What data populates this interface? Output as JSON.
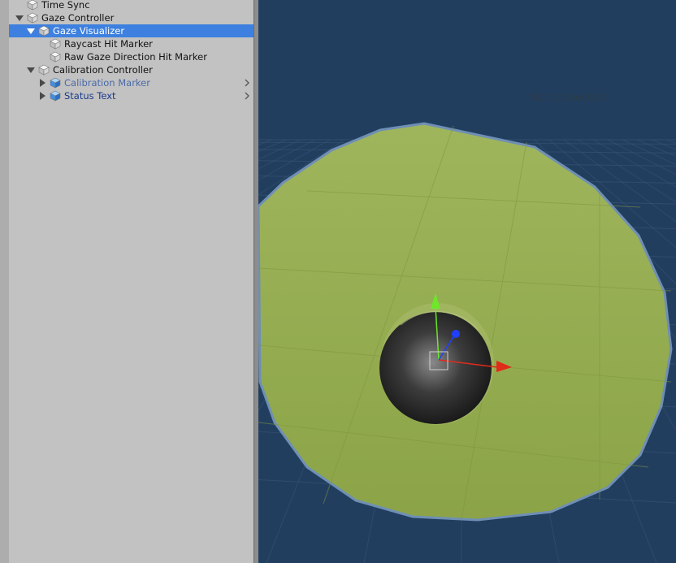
{
  "hierarchy": {
    "items": [
      {
        "label": "Time Sync",
        "indent": 1,
        "expand": "none",
        "icon": "gameobject-icon",
        "selected": false,
        "style": "normal"
      },
      {
        "label": "Gaze Controller",
        "indent": 1,
        "expand": "expanded",
        "icon": "gameobject-icon",
        "selected": false,
        "style": "normal"
      },
      {
        "label": "Gaze Visualizer",
        "indent": 2,
        "expand": "expanded",
        "icon": "gameobject-icon",
        "selected": true,
        "style": "normal"
      },
      {
        "label": "Raycast Hit Marker",
        "indent": 3,
        "expand": "none",
        "icon": "gameobject-icon",
        "selected": false,
        "style": "normal"
      },
      {
        "label": "Raw Gaze Direction Hit Marker",
        "indent": 3,
        "expand": "none",
        "icon": "gameobject-icon",
        "selected": false,
        "style": "normal"
      },
      {
        "label": "Calibration Controller",
        "indent": 2,
        "expand": "expanded",
        "icon": "gameobject-icon",
        "selected": false,
        "style": "normal"
      },
      {
        "label": "Calibration Marker",
        "indent": 3,
        "expand": "collapsed",
        "icon": "prefab-icon",
        "selected": false,
        "style": "prefab-inactive",
        "chevron": true
      },
      {
        "label": "Status Text",
        "indent": 3,
        "expand": "collapsed",
        "icon": "prefab-icon",
        "selected": false,
        "style": "prefab",
        "chevron": true
      }
    ]
  },
  "scene": {
    "status_text": "Not connected!",
    "colors": {
      "background": "#223e5f",
      "grid": "#3a5677",
      "disc_fill": "#95ad4c",
      "disc_edge": "#6f8fb5",
      "sphere": "#3a3a3a",
      "gizmo_x": "#e02a1a",
      "gizmo_y": "#6ee62a",
      "gizmo_z": "#2040ff"
    }
  }
}
